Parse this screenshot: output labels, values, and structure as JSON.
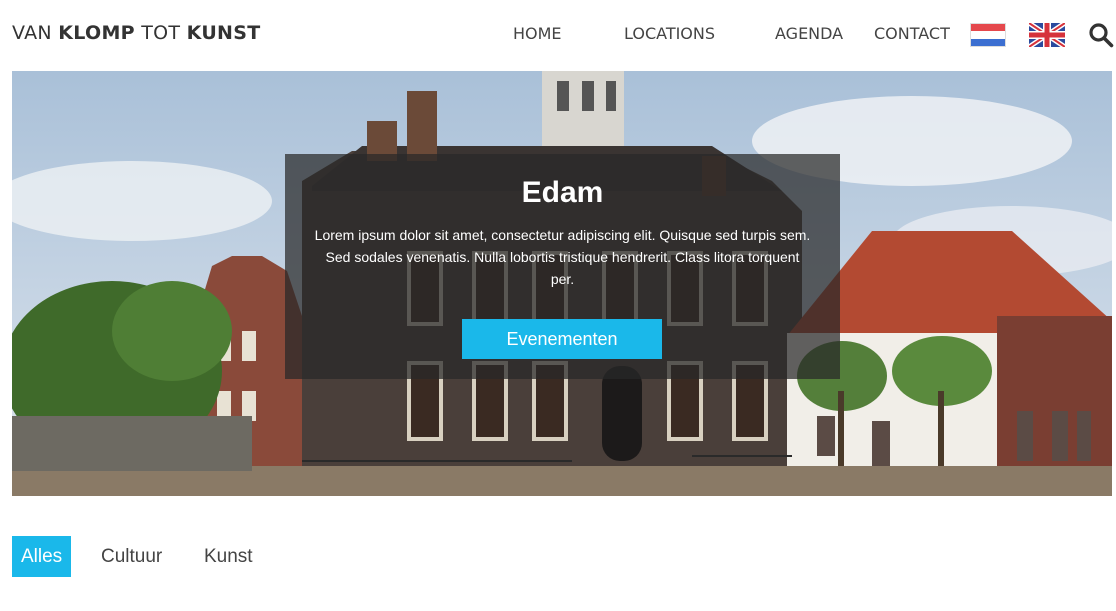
{
  "header": {
    "logo": {
      "part1": "VAN ",
      "part2": "KLOMP",
      "part3": " TOT ",
      "part4": "KUNST"
    },
    "nav": [
      "HOME",
      "LOCATIONS",
      "AGENDA",
      "CONTACT"
    ],
    "flags": [
      "dutch-flag",
      "uk-flag"
    ],
    "search_icon": "search-icon"
  },
  "hero": {
    "title": "Edam",
    "text": "Lorem ipsum dolor sit amet, consectetur adipiscing elit. Quisque sed turpis sem. Sed sodales venenatis. Nulla lobortis tristique hendrerit. Class litora torquent per.",
    "button": "Evenementen"
  },
  "filters": {
    "items": [
      "Alles",
      "Cultuur",
      "Kunst"
    ],
    "active": "Alles"
  },
  "colors": {
    "accent": "#1ab8ea",
    "overlay": "#282828"
  }
}
